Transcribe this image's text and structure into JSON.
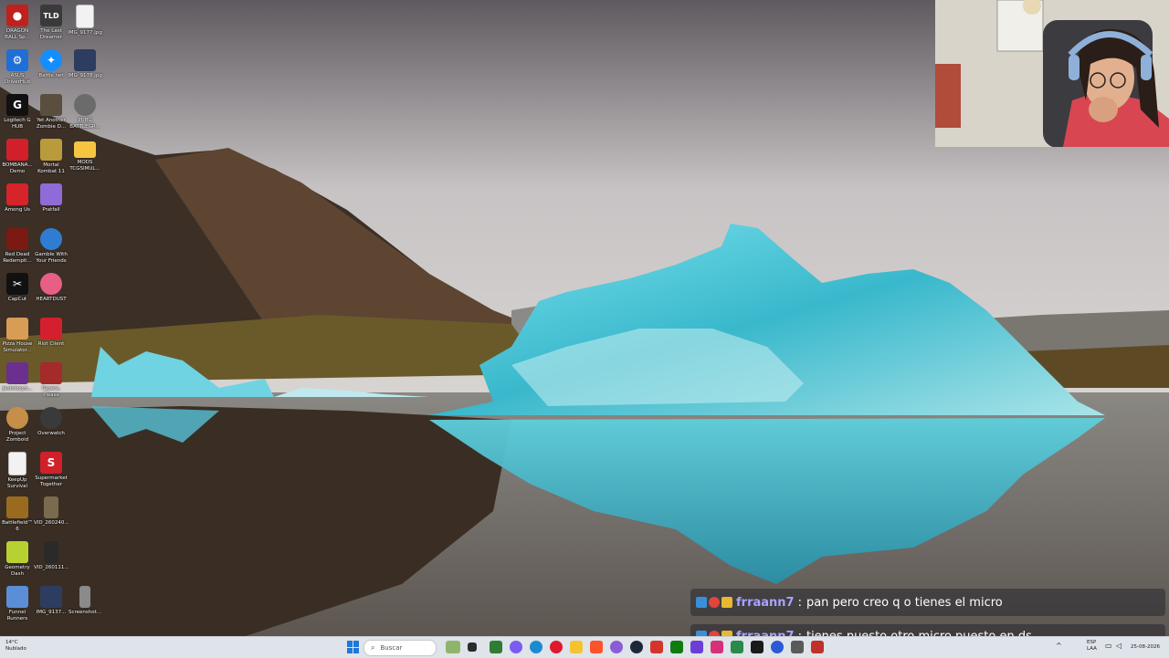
{
  "desktop_icons": [
    {
      "label": "DRAGON BALL Sp...",
      "icon": "dragonball-icon",
      "color": "#c0211c"
    },
    {
      "label": "The Last Dreamer",
      "icon": "tld-icon",
      "color": "#3a3a3a"
    },
    {
      "label": "IMG_9177.jpg",
      "icon": "file-icon",
      "color": "#f2f2f2"
    },
    {
      "label": "ASUS DriverHub",
      "icon": "asus-icon",
      "color": "#1f6fd6"
    },
    {
      "label": "Battle.net",
      "icon": "battlenet-icon",
      "color": "#148eff"
    },
    {
      "label": "IMG_9178.jpg",
      "icon": "image-icon",
      "color": "#2d3d60"
    },
    {
      "label": "Logitech G HUB",
      "icon": "logitech-icon",
      "color": "#111111"
    },
    {
      "label": "Yet Another Zombie D...",
      "icon": "zombie-icon",
      "color": "#5a4e3e"
    },
    {
      "label": "PUBG BATTLEGR...",
      "icon": "pubg-icon",
      "color": "#6b6b6b"
    },
    {
      "label": "BOMBANA... Demo",
      "icon": "bombana-icon",
      "color": "#d2202a"
    },
    {
      "label": "Mortal Kombat 11",
      "icon": "mk-icon",
      "color": "#b99b3c"
    },
    {
      "label": "MODS TCGSIMUL...",
      "icon": "folder-icon",
      "color": "#f5c542"
    },
    {
      "label": "Among Us",
      "icon": "amongus-icon",
      "color": "#d6242a"
    },
    {
      "label": "Pratfall",
      "icon": "pratfall-icon",
      "color": "#8e6bd6"
    },
    {
      "label": "Red Dead Redempti...",
      "icon": "rdr-icon",
      "color": "#7a1a12"
    },
    {
      "label": "Gamble With Your Friends",
      "icon": "gamble-icon",
      "color": "#2f7dd2"
    },
    {
      "label": "CapCut",
      "icon": "capcut-icon",
      "color": "#111111"
    },
    {
      "label": "HEARTDUST",
      "icon": "heartdust-icon",
      "color": "#e75f84"
    },
    {
      "label": "Pizza House Simulator...",
      "icon": "pizza-icon",
      "color": "#d89c57"
    },
    {
      "label": "Riot Client",
      "icon": "riot-icon",
      "color": "#d41f2e"
    },
    {
      "label": "javinicoyo...",
      "icon": "app-icon",
      "color": "#6a2f8f"
    },
    {
      "label": "Papers, Please",
      "icon": "papers-icon",
      "color": "#a52a2a"
    },
    {
      "label": "Project Zomboid",
      "icon": "zomboid-icon",
      "color": "#c58e49"
    },
    {
      "label": "Overwatch",
      "icon": "overwatch-icon",
      "color": "#3a3a3a"
    },
    {
      "label": "KeepUp Survival",
      "icon": "file-icon",
      "color": "#f2f2f2"
    },
    {
      "label": "Supermarket Together",
      "icon": "supermarket-icon",
      "color": "#d0202a"
    },
    {
      "label": "Battlefield™ 6",
      "icon": "battlefield-icon",
      "color": "#9a6b1e"
    },
    {
      "label": "VID_260240...",
      "icon": "video-icon",
      "color": "#7a6a4e"
    },
    {
      "label": "Geometry Dash",
      "icon": "geometrydash-icon",
      "color": "#b8d132"
    },
    {
      "label": "VID_260111...",
      "icon": "video-icon",
      "color": "#2a2a2a"
    },
    {
      "label": "Funnel Runners",
      "icon": "funnel-icon",
      "color": "#5b8ed6"
    },
    {
      "label": "IMG_9137...",
      "icon": "image-icon",
      "color": "#2d3d60"
    },
    {
      "label": "Screenshot...",
      "icon": "screenshot-icon",
      "color": "#8a8a8a"
    }
  ],
  "chat": {
    "messages": [
      {
        "username": "frraann7",
        "separator": ":",
        "text": "pan pero creo q o tienes el micro"
      },
      {
        "username": "frraann7",
        "separator": ":",
        "text": "tienes puesto otro micro puesto en ds"
      }
    ],
    "badge_colors": [
      "#3a8fd8",
      "#e2453c",
      "#e8b82e"
    ]
  },
  "taskbar": {
    "weather_temp": "14°C",
    "weather_desc": "Nublado",
    "search_placeholder": "Buscar",
    "language": "ESP",
    "layout": "LAA",
    "date": "25-08-2026",
    "app_icons": [
      {
        "icon": "game-icon",
        "color": "#8fb56a"
      },
      {
        "icon": "task-view-icon",
        "color": "#2b2b2b"
      },
      {
        "icon": "app-icon",
        "color": "#2e7d32"
      },
      {
        "icon": "copilot-icon",
        "color": "#7a5cf0"
      },
      {
        "icon": "edge-icon",
        "color": "#1b8bd0"
      },
      {
        "icon": "opera-icon",
        "color": "#e0182d"
      },
      {
        "icon": "file-explorer-icon",
        "color": "#f4c430"
      },
      {
        "icon": "brave-icon",
        "color": "#fb542b"
      },
      {
        "icon": "app-icon",
        "color": "#8a5cd6"
      },
      {
        "icon": "steam-icon",
        "color": "#1b2838"
      },
      {
        "icon": "app-icon",
        "color": "#d4352a"
      },
      {
        "icon": "xbox-icon",
        "color": "#107c10"
      },
      {
        "icon": "app-icon",
        "color": "#6b3fd6"
      },
      {
        "icon": "app-icon",
        "color": "#d6307a"
      },
      {
        "icon": "app-icon",
        "color": "#2a8a4a"
      },
      {
        "icon": "capcut-icon",
        "color": "#1a1a1a"
      },
      {
        "icon": "app-icon",
        "color": "#2a5ad6"
      },
      {
        "icon": "app-icon",
        "color": "#5a5a5a"
      },
      {
        "icon": "obs-icon",
        "color": "#c0312a"
      }
    ]
  }
}
